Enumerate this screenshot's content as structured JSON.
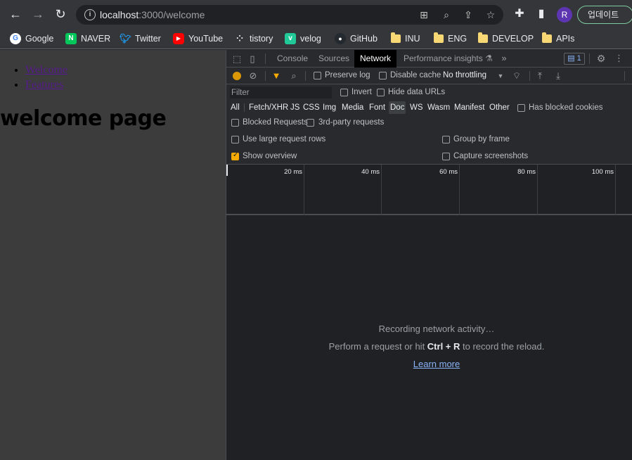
{
  "browser": {
    "url_host": "localhost",
    "url_path": ":3000/welcome",
    "profile_initial": "R",
    "update_label": "업데이트",
    "bookmarks": [
      {
        "label": "Google",
        "icon": "google-icon"
      },
      {
        "label": "NAVER",
        "icon": "naver-icon"
      },
      {
        "label": "Twitter",
        "icon": "twitter-icon"
      },
      {
        "label": "YouTube",
        "icon": "youtube-icon"
      },
      {
        "label": "tistory",
        "icon": "tistory-icon"
      },
      {
        "label": "velog",
        "icon": "velog-icon"
      },
      {
        "label": "GitHub",
        "icon": "github-icon"
      },
      {
        "label": "INU",
        "icon": "folder-icon"
      },
      {
        "label": "ENG",
        "icon": "folder-icon"
      },
      {
        "label": "DEVELOP",
        "icon": "folder-icon"
      },
      {
        "label": "APIs",
        "icon": "folder-icon"
      }
    ]
  },
  "page": {
    "links": [
      "Welcome",
      "Features"
    ],
    "heading": "welcome page"
  },
  "devtools": {
    "tabs": [
      "Console",
      "Sources",
      "Network",
      "Performance insights"
    ],
    "active_tab": "Network",
    "issues_count": "1",
    "toolbar": {
      "preserve_log": "Preserve log",
      "disable_cache": "Disable cache",
      "throttling": "No throttling"
    },
    "filter": {
      "placeholder": "Filter",
      "invert": "Invert",
      "hide_data_urls": "Hide data URLs",
      "types": [
        "All",
        "Fetch/XHR",
        "JS",
        "CSS",
        "Img",
        "Media",
        "Font",
        "Doc",
        "WS",
        "Wasm",
        "Manifest",
        "Other"
      ],
      "selected_type": "Doc",
      "has_blocked_cookies": "Has blocked cookies",
      "blocked_requests": "Blocked Requests",
      "third_party": "3rd-party requests"
    },
    "settings": {
      "large_rows": "Use large request rows",
      "group_by_frame": "Group by frame",
      "show_overview": "Show overview",
      "capture_screenshots": "Capture screenshots"
    },
    "timeline_ticks": [
      "20 ms",
      "40 ms",
      "60 ms",
      "80 ms",
      "100 ms"
    ],
    "empty": {
      "line1": "Recording network activity…",
      "line2_pre": "Perform a request or hit ",
      "line2_key": "Ctrl + R",
      "line2_post": " to record the reload.",
      "learn_more": "Learn more"
    }
  },
  "colors": {
    "accent": "#f9ab00",
    "link": "#8ab4f8",
    "devtools_bg": "#202124"
  }
}
